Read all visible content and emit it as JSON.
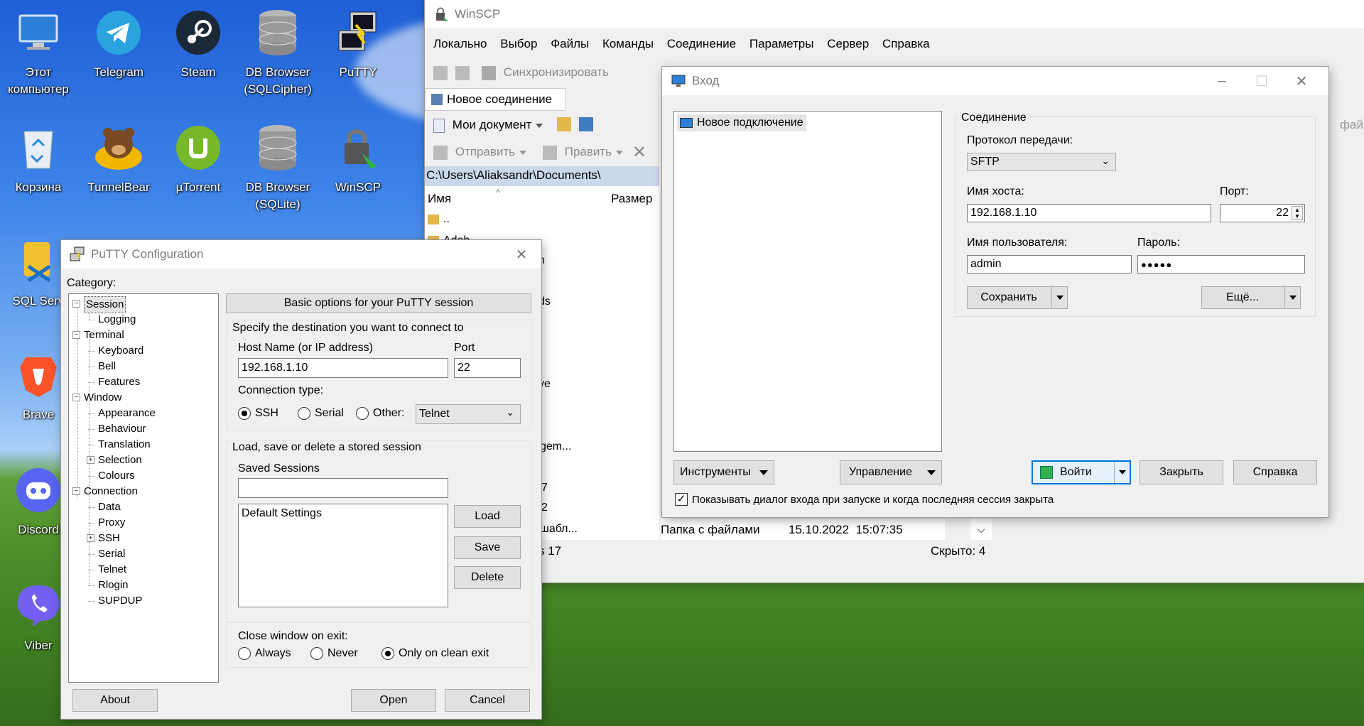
{
  "desktop": {
    "icons": [
      {
        "label": "Этот компьютер",
        "icon": "computer-icon"
      },
      {
        "label": "Telegram",
        "icon": "telegram-icon"
      },
      {
        "label": "Steam",
        "icon": "steam-icon"
      },
      {
        "label": "DB Browser (SQLCipher)",
        "icon": "database-icon"
      },
      {
        "label": "PuTTY",
        "icon": "putty-icon"
      },
      {
        "label": "Корзина",
        "icon": "recycle-bin-icon"
      },
      {
        "label": "TunnelBear",
        "icon": "tunnelbear-icon"
      },
      {
        "label": "µTorrent",
        "icon": "utorrent-icon"
      },
      {
        "label": "DB Browser (SQLite)",
        "icon": "database-icon"
      },
      {
        "label": "WinSCP",
        "icon": "winscp-icon"
      },
      {
        "label": "SQL Serv",
        "icon": "sql-server-icon"
      },
      {
        "label": "Brave",
        "icon": "brave-icon"
      },
      {
        "label": "Discord",
        "icon": "discord-icon"
      },
      {
        "label": "Viber",
        "icon": "viber-icon"
      }
    ]
  },
  "winscp": {
    "title": "WinSCP",
    "menu": [
      "Локально",
      "Выбор",
      "Файлы",
      "Команды",
      "Соединение",
      "Параметры",
      "Сервер",
      "Справка"
    ],
    "sync_label": "Синхронизировать",
    "new_session_tab": "Новое соединение",
    "local_dir": "Мои документ",
    "send_label": "Отправить",
    "edit_label": "Править",
    "path": "C:\\Users\\Aliaksandr\\Documents\\",
    "col_name": "Имя",
    "col_size": "Размер",
    "rows": [
      "..",
      "Adob",
      "n",
      "ds",
      "ve",
      "gem...",
      "7",
      "2"
    ],
    "last_row": {
      "name": "шабл...",
      "type": "Папка с файлами",
      "date": "15.10.2022  15:07:35"
    },
    "status_left": "s 17",
    "status_hidden": "Скрыто: 4",
    "right_col_partial": "фай"
  },
  "login": {
    "title": "Вход",
    "site_item": "Новое подключение",
    "group_title": "Соединение",
    "protocol_label": "Протокол передачи:",
    "protocol_value": "SFTP",
    "host_label": "Имя хоста:",
    "host_value": "192.168.1.10",
    "port_label": "Порт:",
    "port_value": "22",
    "user_label": "Имя пользователя:",
    "user_value": "admin",
    "pass_label": "Пароль:",
    "pass_value": "●●●●●",
    "save_btn": "Сохранить",
    "more_btn": "Ещё...",
    "tools_btn": "Инструменты",
    "manage_btn": "Управление",
    "login_btn": "Войти",
    "close_btn": "Закрыть",
    "help_btn": "Справка",
    "show_dialog_checkbox": "Показывать диалог входа при запуске и когда последняя сессия закрыта"
  },
  "putty": {
    "title": "PuTTY Configuration",
    "category_label": "Category:",
    "tree": [
      {
        "label": "Session",
        "level": 0,
        "expand": "-"
      },
      {
        "label": "Logging",
        "level": 1
      },
      {
        "label": "Terminal",
        "level": 0,
        "expand": "-"
      },
      {
        "label": "Keyboard",
        "level": 1
      },
      {
        "label": "Bell",
        "level": 1
      },
      {
        "label": "Features",
        "level": 1
      },
      {
        "label": "Window",
        "level": 0,
        "expand": "-"
      },
      {
        "label": "Appearance",
        "level": 1
      },
      {
        "label": "Behaviour",
        "level": 1
      },
      {
        "label": "Translation",
        "level": 1
      },
      {
        "label": "Selection",
        "level": 1,
        "expand": "+"
      },
      {
        "label": "Colours",
        "level": 1
      },
      {
        "label": "Connection",
        "level": 0,
        "expand": "-"
      },
      {
        "label": "Data",
        "level": 1
      },
      {
        "label": "Proxy",
        "level": 1
      },
      {
        "label": "SSH",
        "level": 1,
        "expand": "+"
      },
      {
        "label": "Serial",
        "level": 1
      },
      {
        "label": "Telnet",
        "level": 1
      },
      {
        "label": "Rlogin",
        "level": 1
      },
      {
        "label": "SUPDUP",
        "level": 1
      }
    ],
    "header_btn": "Basic options for your PuTTY session",
    "dest_title": "Specify the destination you want to connect to",
    "host_label": "Host Name (or IP address)",
    "host_value": "192.168.1.10",
    "port_label": "Port",
    "port_value": "22",
    "conn_type_label": "Connection type:",
    "ssh": "SSH",
    "serial": "Serial",
    "other": "Other:",
    "other_value": "Telnet",
    "sessions_title": "Load, save or delete a stored session",
    "saved_sessions_label": "Saved Sessions",
    "saved_sessions_value": "",
    "sessions_list": [
      "Default Settings"
    ],
    "load_btn": "Load",
    "save_btn": "Save",
    "delete_btn": "Delete",
    "close_title": "Close window on exit:",
    "always": "Always",
    "never": "Never",
    "clean": "Only on clean exit",
    "about_btn": "About",
    "open_btn": "Open",
    "cancel_btn": "Cancel"
  }
}
